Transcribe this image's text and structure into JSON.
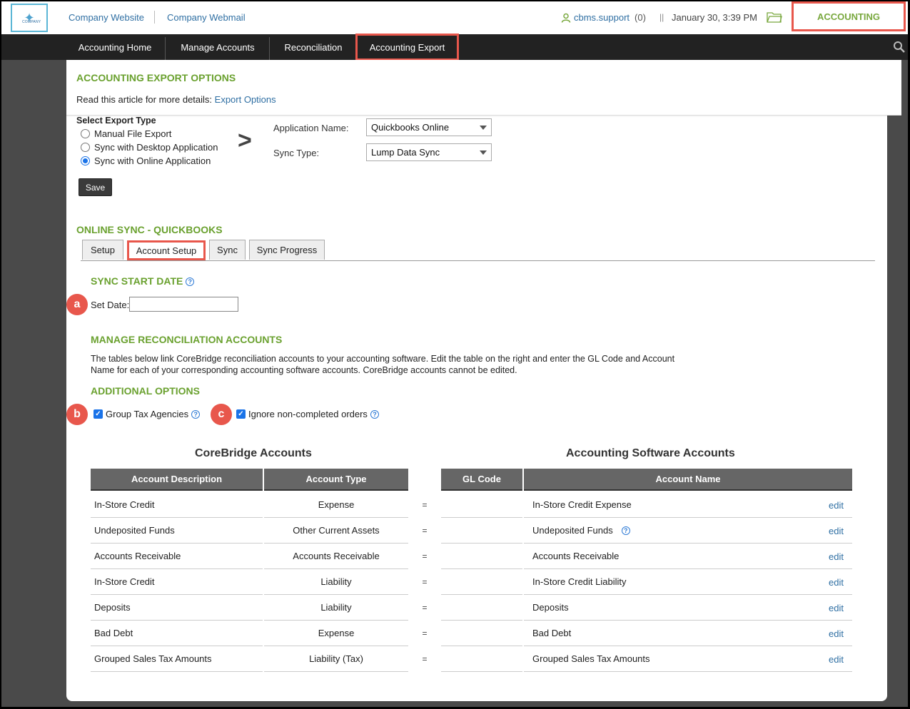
{
  "topbar": {
    "logo_text": "COMPANY",
    "links": [
      "Company Website",
      "Company Webmail"
    ],
    "user": "cbms.support",
    "user_count": "(0)",
    "date": "January 30, 3:39 PM",
    "module": "ACCOUNTING"
  },
  "nav": {
    "items": [
      "Accounting Home",
      "Manage Accounts",
      "Reconciliation",
      "Accounting Export"
    ]
  },
  "export_options": {
    "title": "ACCOUNTING EXPORT OPTIONS",
    "read_text": "Read this article for more details:",
    "read_link": "Export Options",
    "type_label": "Select Export Type",
    "radios": [
      "Manual File Export",
      "Sync with Desktop Application",
      "Sync with Online Application"
    ],
    "selected": "Sync with Online Application",
    "app_name_label": "Application Name:",
    "app_name_value": "Quickbooks Online",
    "sync_type_label": "Sync Type:",
    "sync_type_value": "Lump Data Sync",
    "save_label": "Save",
    "arrow": ">"
  },
  "online_sync": {
    "title": "ONLINE SYNC - QUICKBOOKS",
    "tabs": [
      "Setup",
      "Account Setup",
      "Sync",
      "Sync Progress"
    ],
    "active_tab": "Account Setup"
  },
  "sync_start": {
    "title": "SYNC START DATE",
    "set_date_label": "Set Date:",
    "set_date_value": ""
  },
  "reconciliation": {
    "title": "MANAGE RECONCILIATION ACCOUNTS",
    "description": "The tables below link CoreBridge reconciliation accounts to your accounting software. Edit the table on the right and enter the GL Code and Account Name for each of your corresponding accounting software accounts. CoreBridge accounts cannot be edited."
  },
  "additional": {
    "title": "ADDITIONAL OPTIONS",
    "group_tax": "Group Tax Agencies",
    "ignore_orders": "Ignore non-completed orders",
    "group_tax_checked": true,
    "ignore_orders_checked": true
  },
  "badges": [
    "a",
    "b",
    "c"
  ],
  "tables": {
    "left_title": "CoreBridge Accounts",
    "right_title": "Accounting Software Accounts",
    "left_headers": [
      "Account Description",
      "Account Type"
    ],
    "right_headers": [
      "GL Code",
      "Account Name"
    ],
    "equals": "=",
    "edit_label": "edit",
    "rows": [
      {
        "desc": "In-Store Credit",
        "type": "Expense",
        "gl": "",
        "name": "In-Store Credit Expense"
      },
      {
        "desc": "Undeposited Funds",
        "type": "Other Current Assets",
        "gl": "",
        "name": "Undeposited Funds"
      },
      {
        "desc": "Accounts Receivable",
        "type": "Accounts Receivable",
        "gl": "",
        "name": "Accounts Receivable"
      },
      {
        "desc": "In-Store Credit",
        "type": "Liability",
        "gl": "",
        "name": "In-Store Credit Liability"
      },
      {
        "desc": "Deposits",
        "type": "Liability",
        "gl": "",
        "name": "Deposits"
      },
      {
        "desc": "Bad Debt",
        "type": "Expense",
        "gl": "",
        "name": "Bad Debt"
      },
      {
        "desc": "Grouped Sales Tax Amounts",
        "type": "Liability (Tax)",
        "gl": "",
        "name": "Grouped Sales Tax Amounts"
      }
    ]
  },
  "colors": {
    "accent_green": "#6aa12f",
    "highlight_red": "#e8574c",
    "link_blue": "#2f6fa3",
    "nav_bg": "#222222"
  }
}
